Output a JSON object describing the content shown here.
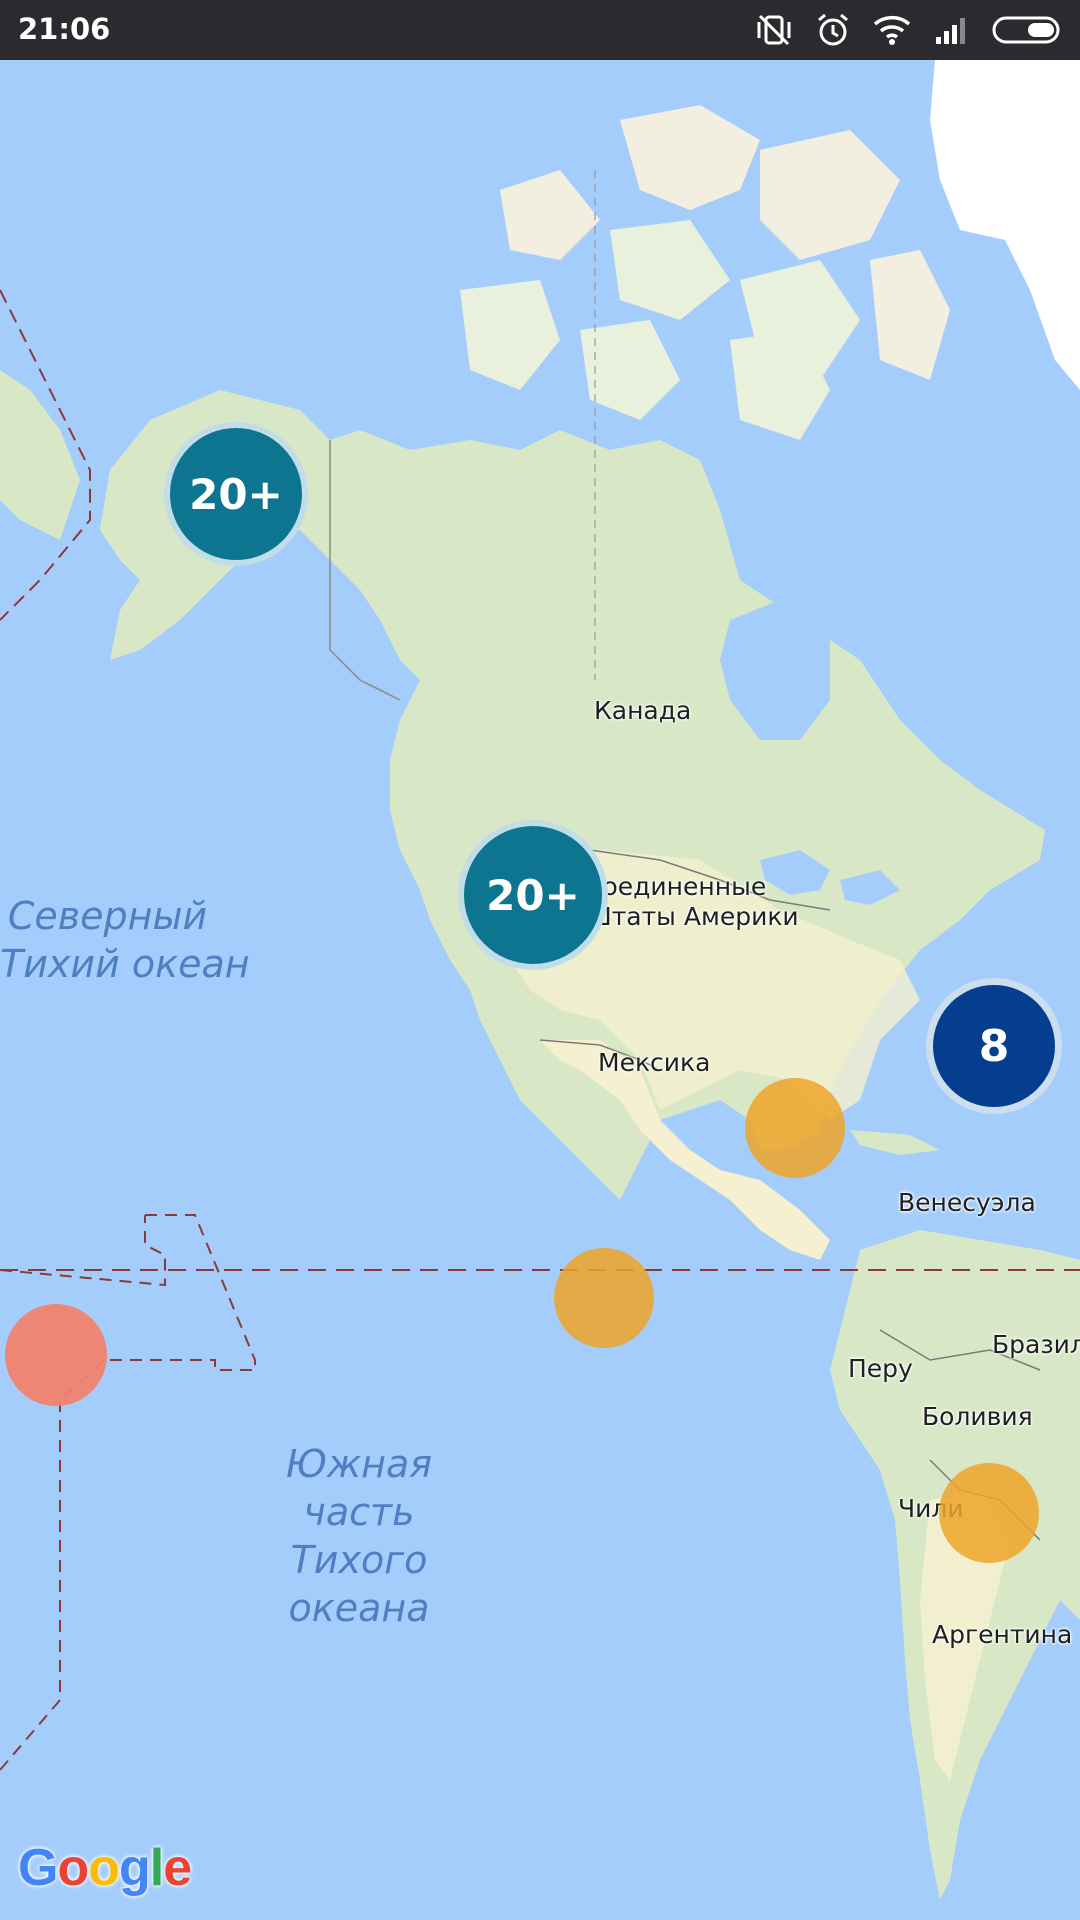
{
  "status_bar": {
    "time": "21:06"
  },
  "map": {
    "countries": [
      {
        "id": "canada",
        "text": "Канада"
      },
      {
        "id": "usa",
        "text": "Соединенные\nШтаты Америки"
      },
      {
        "id": "mexico",
        "text": "Мексика"
      },
      {
        "id": "venezuela",
        "text": "Венесуэла"
      },
      {
        "id": "peru",
        "text": "Перу"
      },
      {
        "id": "brazil",
        "text": "Бразил"
      },
      {
        "id": "bolivia",
        "text": "Боливия"
      },
      {
        "id": "chile",
        "text": "Чили"
      },
      {
        "id": "argentina",
        "text": "Аргентина"
      }
    ],
    "oceans": [
      {
        "id": "north-pacific",
        "text": "Северный\nТихий океан"
      },
      {
        "id": "south-pacific",
        "text": "Южная\nчасть\nТихого\nокеана"
      }
    ],
    "clusters": [
      {
        "id": "alaska",
        "label": "20+",
        "color": "#0e7590"
      },
      {
        "id": "us-west",
        "label": "20+",
        "color": "#0e7590"
      },
      {
        "id": "atlantic",
        "label": "8",
        "color": "#053e8f"
      }
    ],
    "markers": [
      {
        "id": "central-america",
        "color": "#eda428"
      },
      {
        "id": "pacific-equator",
        "color": "#eda428"
      },
      {
        "id": "bolivia",
        "color": "#eda428"
      },
      {
        "id": "polynesia",
        "color": "#f0826e"
      }
    ],
    "attribution": [
      "G",
      "o",
      "o",
      "g",
      "l",
      "e"
    ],
    "attribution_colors": [
      "#4285f4",
      "#ea4335",
      "#fbbc05",
      "#4285f4",
      "#34a853",
      "#ea4335"
    ]
  }
}
